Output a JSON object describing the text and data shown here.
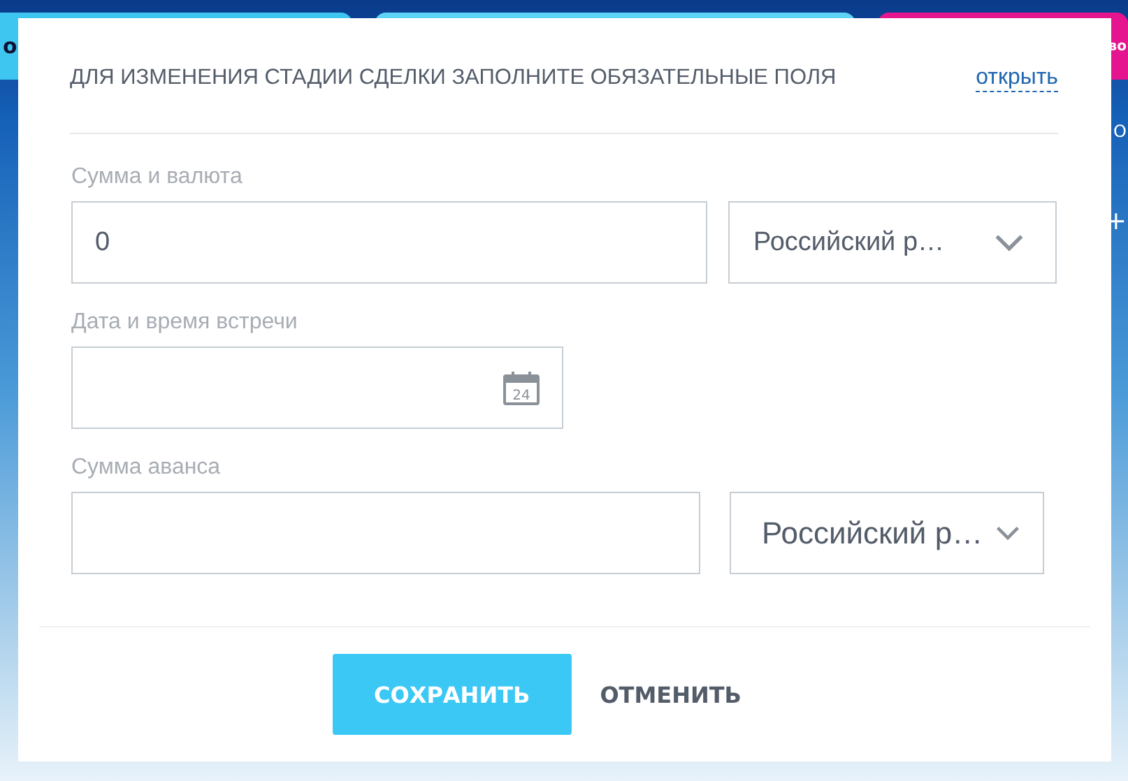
{
  "background": {
    "left_tab": "о",
    "right_tab": "во",
    "side_marks": [
      "О",
      "+"
    ]
  },
  "dialog": {
    "title": "ДЛЯ ИЗМЕНЕНИЯ СТАДИИ СДЕЛКИ ЗАПОЛНИТЕ ОБЯЗАТЕЛЬНЫЕ ПОЛЯ",
    "link": "открыть",
    "fields": [
      {
        "kind": "amount",
        "label": "Сумма и валюта",
        "value": "0",
        "currency": "Российский р…",
        "large": false
      },
      {
        "kind": "date",
        "label": "Дата и время встречи",
        "icon_text": "24"
      },
      {
        "kind": "amount",
        "label": "Сумма аванса",
        "currency": "Российский р…",
        "large": true
      }
    ],
    "buttons": [
      {
        "label": "СОХРАНИТЬ",
        "kind": "primary"
      },
      {
        "label": "ОТМЕНИТЬ",
        "kind": "link"
      }
    ]
  }
}
